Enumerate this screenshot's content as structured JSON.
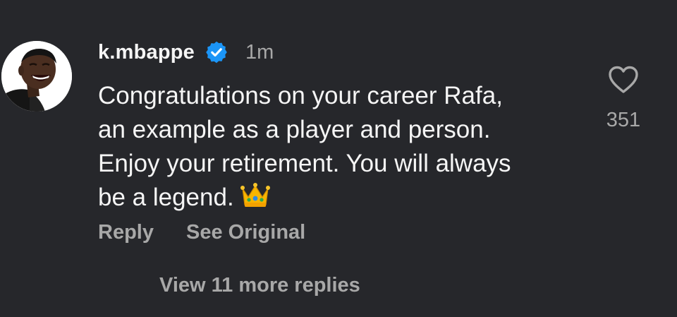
{
  "comment": {
    "username": "k.mbappe",
    "verified": true,
    "timestamp": "1m",
    "text": "Congratulations on your career Rafa,\nan example as a player and person.\nEnjoy your retirement. You will always\nbe a legend.",
    "emoji": "crown",
    "like_count": "351",
    "actions": {
      "reply_label": "Reply",
      "see_original_label": "See Original"
    },
    "view_replies_label": "View 11 more replies"
  },
  "icons": {
    "verified": "verified-badge-icon",
    "like": "heart-outline-icon",
    "emoji": "crown-emoji-icon"
  },
  "colors": {
    "background": "#26272b",
    "primary_text": "#f5f5f5",
    "secondary_text": "#a8a8a8",
    "verified_blue": "#1b95f7"
  }
}
